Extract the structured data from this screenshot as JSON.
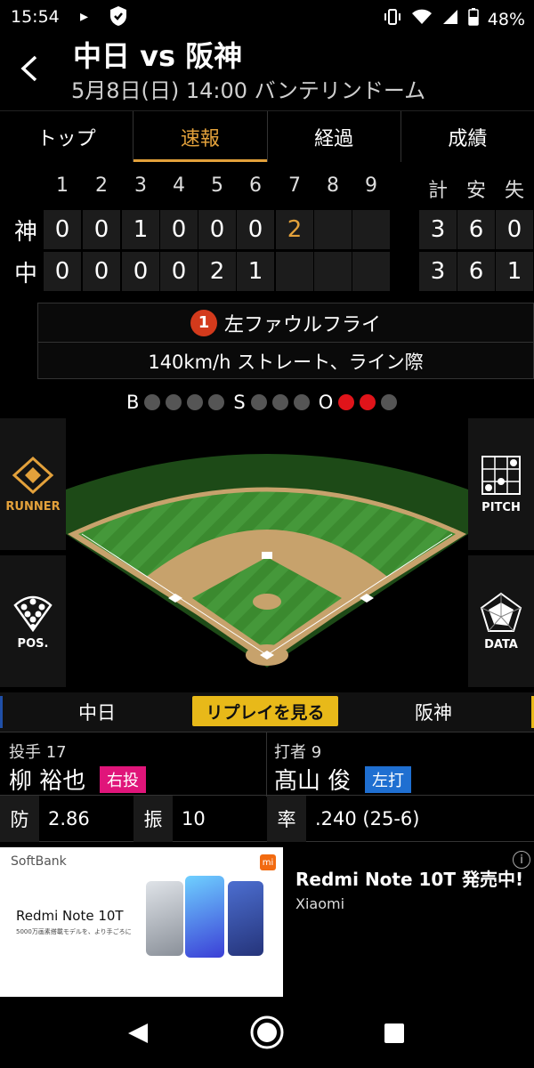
{
  "status": {
    "time": "15:54",
    "battery": "48%"
  },
  "header": {
    "title": "中日 vs 阪神",
    "subtitle": "5月8日(日) 14:00 バンテリンドーム"
  },
  "tabs": [
    {
      "label": "トップ"
    },
    {
      "label": "速報"
    },
    {
      "label": "経過"
    },
    {
      "label": "成績"
    }
  ],
  "scoreboard": {
    "innings": [
      "1",
      "2",
      "3",
      "4",
      "5",
      "6",
      "7",
      "8",
      "9"
    ],
    "totals_headers": [
      "計",
      "安",
      "失"
    ],
    "rows": [
      {
        "team": "神",
        "scores": [
          "0",
          "0",
          "1",
          "0",
          "0",
          "0",
          "2",
          "",
          ""
        ],
        "totals": [
          "3",
          "6",
          "0"
        ]
      },
      {
        "team": "中",
        "scores": [
          "0",
          "0",
          "0",
          "0",
          "2",
          "1",
          "",
          "",
          ""
        ],
        "totals": [
          "3",
          "6",
          "1"
        ]
      }
    ],
    "highlight_color": "#e3a13b"
  },
  "play": {
    "number": "1",
    "result": "左ファウルフライ",
    "pitch": "140km/h ストレート、ライン際"
  },
  "count": {
    "b_label": "B",
    "s_label": "S",
    "o_label": "O",
    "balls": 0,
    "strikes": 0,
    "outs": 2
  },
  "sidebuttons": {
    "runner": "RUNNER",
    "pitch": "PITCH",
    "pos": "POS.",
    "data": "DATA"
  },
  "teambar": {
    "home": "中日",
    "away": "阪神",
    "replay": "リプレイを見る"
  },
  "pitcher": {
    "label": "投手 17",
    "name": "柳 裕也",
    "hand": "右投",
    "era_label": "防",
    "era": "2.86",
    "k_label": "振",
    "k": "10"
  },
  "batter": {
    "label": "打者 9",
    "name": "髙山 俊",
    "hand": "左打",
    "avg_label": "率",
    "avg": ".240 (25-6)"
  },
  "ad": {
    "brand": "SoftBank",
    "model": "Redmi Note 10T",
    "tagline": "5000万画素搭載モデルを、より手ごろに",
    "headline": "Redmi Note 10T 発売中!",
    "advertiser": "Xiaomi",
    "mi_logo": "mi"
  },
  "colors": {
    "accent": "#e3a13b",
    "ball_badge": "#d33a1c",
    "out_on": "#e0141a",
    "pitcher_hand": "#e0157a",
    "batter_hand": "#1f6fd1",
    "replay": "#e8b919"
  }
}
